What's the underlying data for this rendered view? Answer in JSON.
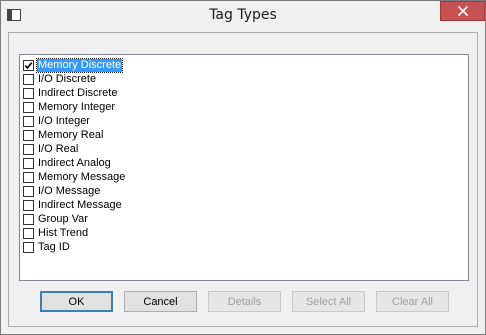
{
  "window": {
    "title": "Tag Types"
  },
  "tag_list": {
    "items": [
      {
        "label": "Memory Discrete",
        "checked": true,
        "selected": true
      },
      {
        "label": "I/O Discrete",
        "checked": false
      },
      {
        "label": "Indirect Discrete",
        "checked": false
      },
      {
        "label": "Memory Integer",
        "checked": false
      },
      {
        "label": "I/O Integer",
        "checked": false
      },
      {
        "label": "Memory Real",
        "checked": false
      },
      {
        "label": "I/O Real",
        "checked": false
      },
      {
        "label": "Indirect Analog",
        "checked": false
      },
      {
        "label": "Memory Message",
        "checked": false
      },
      {
        "label": "I/O Message",
        "checked": false
      },
      {
        "label": "Indirect Message",
        "checked": false
      },
      {
        "label": "Group Var",
        "checked": false
      },
      {
        "label": "Hist Trend",
        "checked": false
      },
      {
        "label": "Tag ID",
        "checked": false
      }
    ]
  },
  "buttons": {
    "ok": "OK",
    "cancel": "Cancel",
    "details": "Details",
    "select_all": "Select All",
    "clear_all": "Clear All"
  },
  "colors": {
    "selection": "#3399ff",
    "close_button": "#c75050"
  }
}
